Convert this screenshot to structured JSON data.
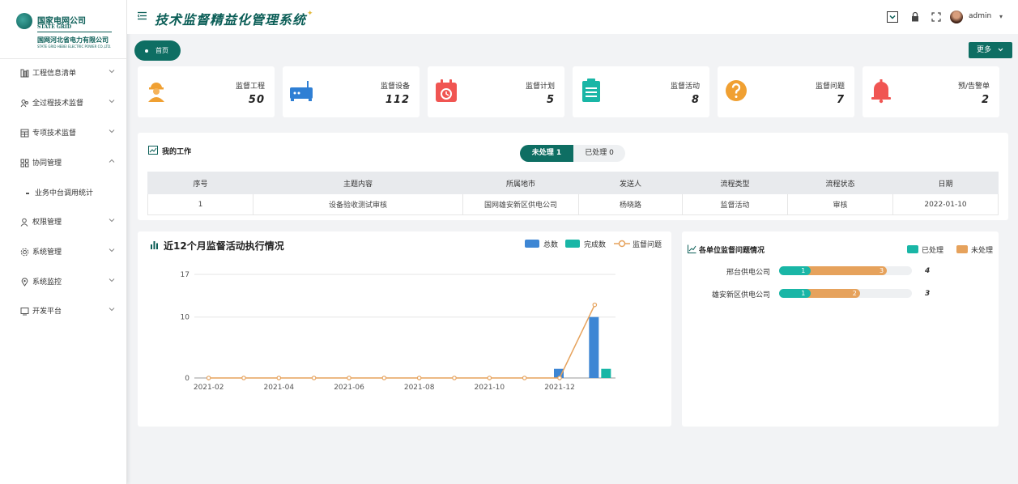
{
  "brand": {
    "name_cn": "国家电网公司",
    "name_en": "STATE GRID",
    "sub_cn": "国网河北省电力有限公司",
    "sub_en": "STATE GRID HEBEI ELECTRIC POWER CO.,LTD.",
    "primary_color": "#0e6e63"
  },
  "sidebar": {
    "items": [
      {
        "label": "工程信息清单",
        "icon": "building-icon"
      },
      {
        "label": "全过程技术监督",
        "icon": "people-icon"
      },
      {
        "label": "专项技术监督",
        "icon": "grid-icon"
      },
      {
        "label": "协同管理",
        "icon": "apps-icon"
      },
      {
        "label": "业务中台调用统计",
        "icon": "dash-icon"
      },
      {
        "label": "权限管理",
        "icon": "user-icon"
      },
      {
        "label": "系统管理",
        "icon": "gear-icon"
      },
      {
        "label": "系统监控",
        "icon": "location-icon"
      },
      {
        "label": "开发平台",
        "icon": "monitor-icon"
      }
    ]
  },
  "header": {
    "title": "技术监督精益化管理系统",
    "user": "admin"
  },
  "tabs": {
    "home": "首页"
  },
  "more_label": "更多",
  "stats": [
    {
      "label": "监督工程",
      "value": "50",
      "icon": "worker-icon"
    },
    {
      "label": "监督设备",
      "value": "112",
      "icon": "device-icon"
    },
    {
      "label": "监督计划",
      "value": "5",
      "icon": "calendar-icon"
    },
    {
      "label": "监督活动",
      "value": "8",
      "icon": "clipboard-icon"
    },
    {
      "label": "监督问题",
      "value": "7",
      "icon": "question-icon"
    },
    {
      "label": "预/告警单",
      "value": "2",
      "icon": "bell-icon"
    }
  ],
  "work": {
    "title": "我的工作",
    "pending": "未处理 1",
    "done": "已处理 0",
    "columns": [
      "序号",
      "主题内容",
      "所属地市",
      "发送人",
      "流程类型",
      "流程状态",
      "日期"
    ],
    "rows": [
      [
        "1",
        "设备验收测试审核",
        "国网雄安新区供电公司",
        "杨晓路",
        "监督活动",
        "审核",
        "2022-01-10"
      ]
    ]
  },
  "activity_chart": {
    "title": "近12个月监督活动执行情况"
  },
  "chart_data": [
    {
      "type": "bar",
      "title": "近12个月监督活动执行情况",
      "x": [
        "2021-02",
        "2021-03",
        "2021-04",
        "2021-05",
        "2021-06",
        "2021-07",
        "2021-08",
        "2021-09",
        "2021-10",
        "2021-11",
        "2021-12",
        "2022-01"
      ],
      "x_tick_labels": [
        "2021-02",
        "2021-04",
        "2021-06",
        "2021-08",
        "2021-10",
        "2021-12"
      ],
      "y_ticks": [
        "0",
        "10",
        "17"
      ],
      "ylim": [
        0,
        17
      ],
      "grid": true,
      "legend_position": "top-right",
      "series": [
        {
          "name": "总数",
          "type": "bar",
          "color": "#3d86d4",
          "values": [
            0,
            0,
            0,
            0,
            0,
            0,
            0,
            0,
            0,
            0,
            1.5,
            10
          ]
        },
        {
          "name": "完成数",
          "type": "bar",
          "color": "#19b6a6",
          "values": [
            0,
            0,
            0,
            0,
            0,
            0,
            0,
            0,
            0,
            0,
            0,
            1.5
          ]
        },
        {
          "name": "监督问题",
          "type": "line",
          "color": "#e6a25c",
          "values": [
            0,
            0,
            0,
            0,
            0,
            0,
            0,
            0,
            0,
            0,
            0,
            12
          ]
        }
      ]
    },
    {
      "type": "bar",
      "title": "各单位监督问题情况",
      "orientation": "horizontal",
      "stacked": true,
      "categories": [
        "邢台供电公司",
        "雄安新区供电公司"
      ],
      "series": [
        {
          "name": "已处理",
          "color": "#19b6a6",
          "values": [
            1,
            1
          ]
        },
        {
          "name": "未处理",
          "color": "#e6a25c",
          "values": [
            3,
            2
          ]
        }
      ],
      "totals": [
        "4",
        "3"
      ],
      "legend_position": "top-right"
    }
  ]
}
